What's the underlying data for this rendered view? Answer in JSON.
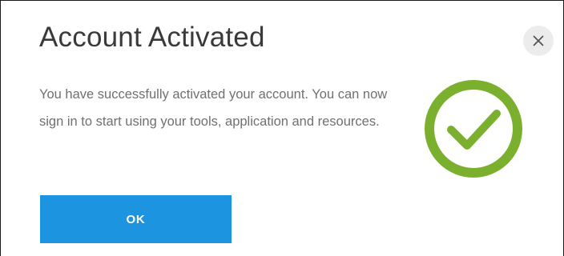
{
  "dialog": {
    "title": "Account Activated",
    "message": "You have successfully activated your account. You can now sign in to start using your tools, application and resources.",
    "ok_label": "OK"
  },
  "icons": {
    "close": "close-icon",
    "success": "checkmark-circle-icon"
  },
  "colors": {
    "success_green": "#7bb02f",
    "button_blue": "#1d94e0",
    "close_bg": "#ececec"
  }
}
